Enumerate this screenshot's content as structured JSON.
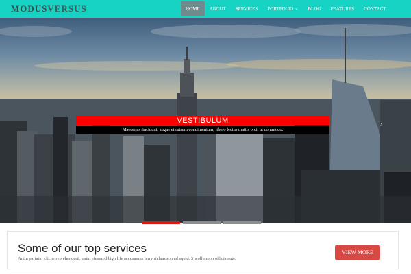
{
  "brand": {
    "part1": "MODUS",
    "part2": "VERSUS"
  },
  "nav": [
    {
      "label": "HOME",
      "active": true
    },
    {
      "label": "ABOUT"
    },
    {
      "label": "SERVICES"
    },
    {
      "label": "PORTFOLIO",
      "dropdown": true
    },
    {
      "label": "BLOG"
    },
    {
      "label": "FEATURES"
    },
    {
      "label": "CONTACT"
    }
  ],
  "hero": {
    "caption_title": "VESTIBULUM",
    "caption_text": "Maecenas tincidunt, augue et rutrum condimentum, libero lectus mattis orci, ut commodo.",
    "indicators": 3,
    "active_slide": 1
  },
  "services": {
    "title": "Some of our top services",
    "text": "Anim pariatur cliche reprehenderit, enim eiusmod high life accusamus terry richardson ad squid. 3 wolf moon officia aute.",
    "button": "VIEW MORE"
  },
  "colors": {
    "nav_bg": "#17d3c3",
    "nav_active": "#6e8b8d",
    "caption_bg": "#ff0000",
    "button_bg": "#d64a43",
    "indicator_active": "#e3150f"
  },
  "icons": {
    "slide_next": "chevron-right-icon",
    "dropdown": "caret-down-icon"
  }
}
